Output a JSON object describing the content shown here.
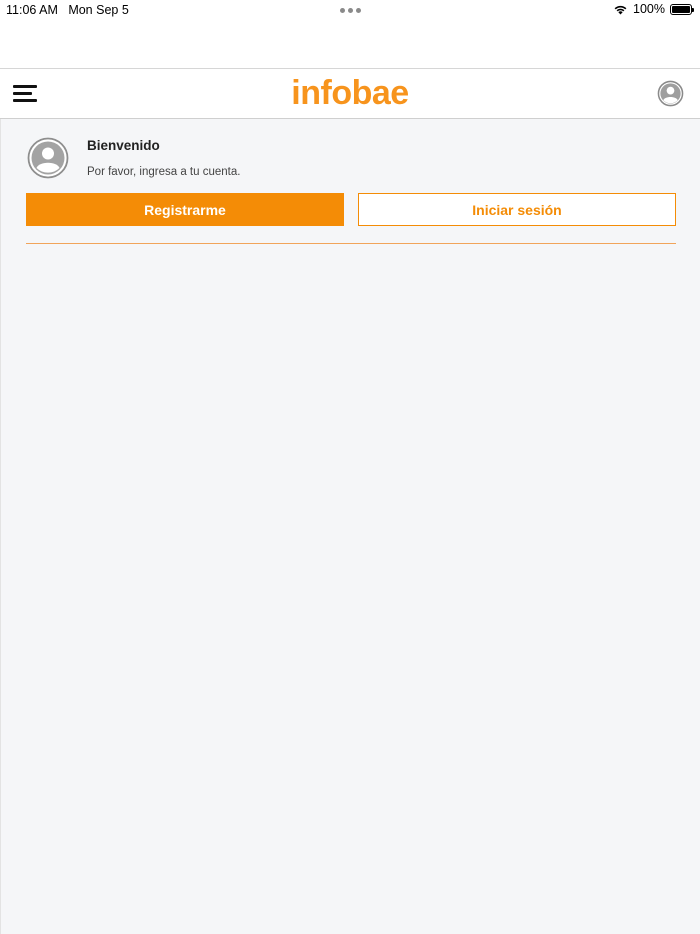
{
  "status_bar": {
    "time": "11:06 AM",
    "date": "Mon Sep 5",
    "battery": "100%"
  },
  "header": {
    "logo": "infobae",
    "brand_color": "#f7941d"
  },
  "account": {
    "title": "Bienvenido",
    "subtitle": "Por favor, ingresa a tu cuenta.",
    "register_label": "Registrarme",
    "login_label": "Iniciar sesión"
  },
  "colors": {
    "accent": "#f48c06",
    "background": "#f5f6f8"
  },
  "icons": {
    "menu": "hamburger-menu-icon",
    "profile": "user-profile-icon",
    "avatar": "user-avatar-icon",
    "wifi": "wifi-icon",
    "battery": "battery-icon"
  }
}
